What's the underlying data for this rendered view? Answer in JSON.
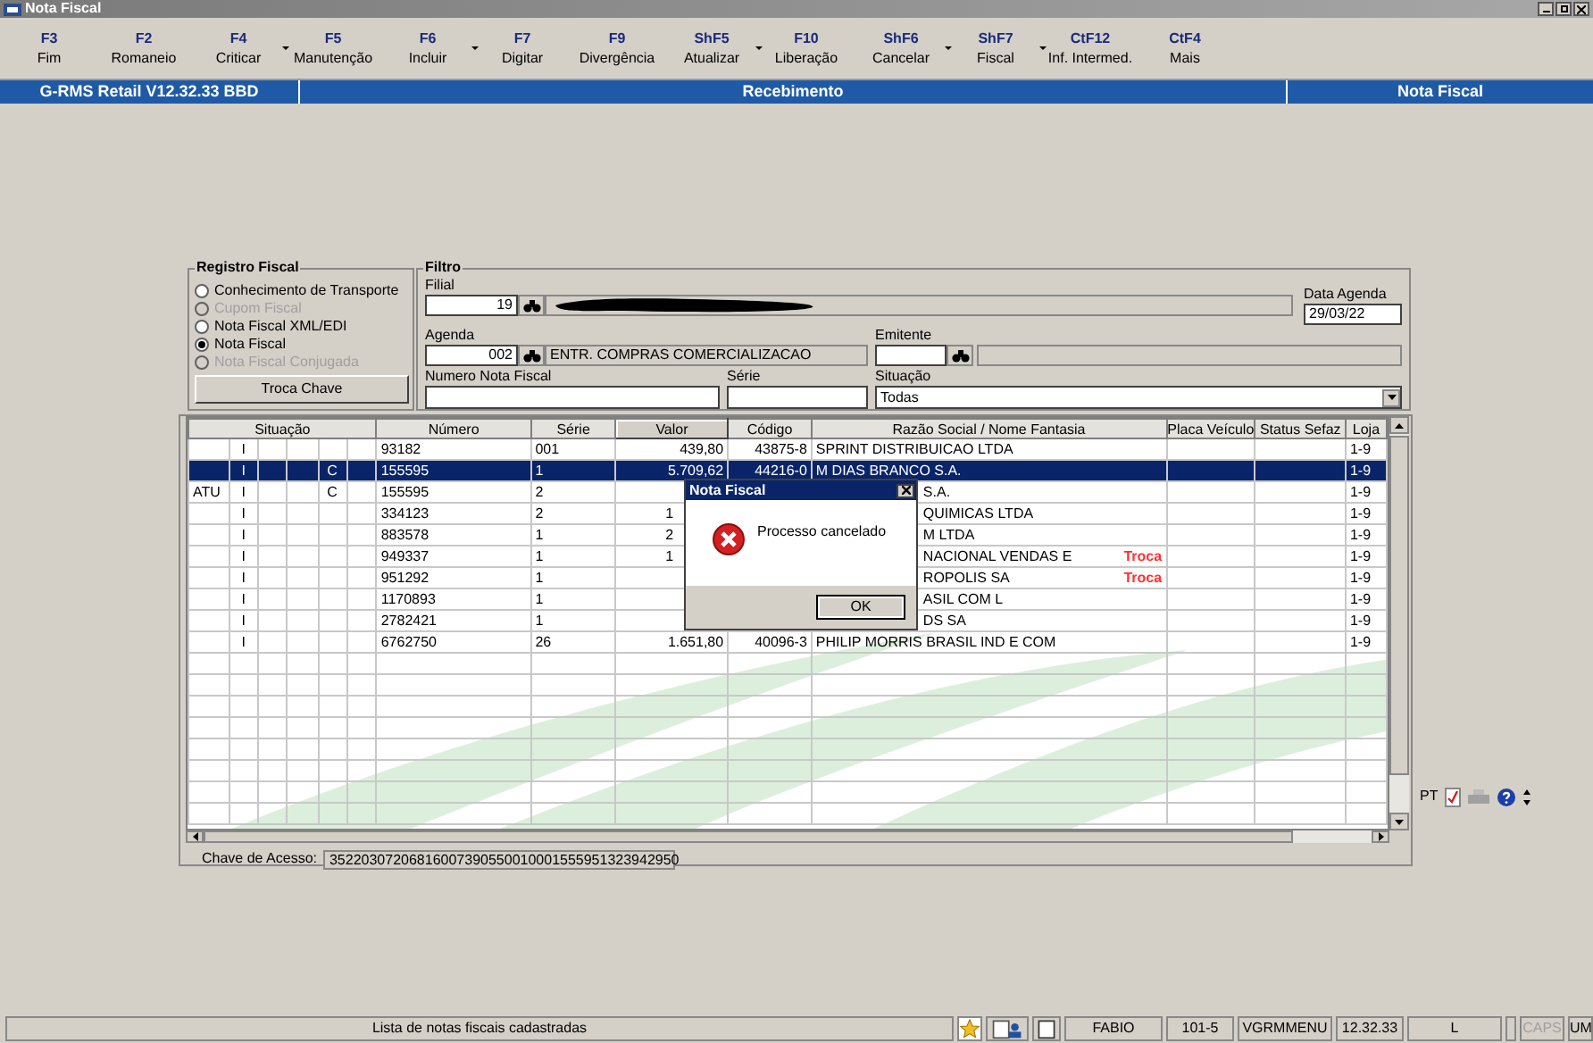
{
  "window": {
    "title": "Nota Fiscal"
  },
  "toolbar": [
    {
      "key": "F3",
      "label": "Fim",
      "has_menu": false
    },
    {
      "key": "F2",
      "label": "Romaneio",
      "has_menu": false
    },
    {
      "key": "F4",
      "label": "Criticar",
      "has_menu": true
    },
    {
      "key": "F5",
      "label": "Manutenção",
      "has_menu": false
    },
    {
      "key": "F6",
      "label": "Incluir",
      "has_menu": true
    },
    {
      "key": "F7",
      "label": "Digitar",
      "has_menu": false
    },
    {
      "key": "F9",
      "label": "Divergência",
      "has_menu": false
    },
    {
      "key": "ShF5",
      "label": "Atualizar",
      "has_menu": true
    },
    {
      "key": "F10",
      "label": "Liberação",
      "has_menu": false
    },
    {
      "key": "ShF6",
      "label": "Cancelar",
      "has_menu": true
    },
    {
      "key": "ShF7",
      "label": "Fiscal",
      "has_menu": true
    },
    {
      "key": "CtF12",
      "label": "Inf. Intermed.",
      "has_menu": false
    },
    {
      "key": "CtF4",
      "label": "Mais",
      "has_menu": false
    }
  ],
  "header_bar": {
    "system": "G-RMS Retail V12.32.33 BBD",
    "module": "Recebimento",
    "screen": "Nota Fiscal"
  },
  "registro_fiscal": {
    "title": "Registro Fiscal",
    "options": [
      {
        "label": "Conhecimento de Transporte",
        "selected": false,
        "disabled": false
      },
      {
        "label": "Cupom Fiscal",
        "selected": false,
        "disabled": true
      },
      {
        "label": "Nota Fiscal XML/EDI",
        "selected": false,
        "disabled": false
      },
      {
        "label": "Nota Fiscal",
        "selected": true,
        "disabled": false
      },
      {
        "label": "Nota Fiscal Conjugada",
        "selected": false,
        "disabled": true
      }
    ],
    "button": "Troca Chave"
  },
  "filtro": {
    "title": "Filtro",
    "filial": {
      "label": "Filial",
      "value": "19"
    },
    "data_agenda": {
      "label": "Data Agenda",
      "value": "29/03/22"
    },
    "agenda": {
      "label": "Agenda",
      "value": "002",
      "description": "ENTR. COMPRAS COMERCIALIZACAO"
    },
    "emitente": {
      "label": "Emitente"
    },
    "numero": {
      "label": "Numero Nota Fiscal"
    },
    "serie": {
      "label": "Série"
    },
    "situacao": {
      "label": "Situação",
      "value": "Todas"
    }
  },
  "table": {
    "columns": [
      {
        "label": "Situação",
        "sorted": false
      },
      {
        "label": "Número",
        "sorted": false
      },
      {
        "label": "Série",
        "sorted": false
      },
      {
        "label": "Valor",
        "sorted": true
      },
      {
        "label": "Código",
        "sorted": false
      },
      {
        "label": "Razão Social / Nome Fantasia",
        "sorted": false
      },
      {
        "label": "Placa Veículo",
        "sorted": false
      },
      {
        "label": "Status Sefaz",
        "sorted": false
      },
      {
        "label": "Loja",
        "sorted": false
      }
    ],
    "rows": [
      {
        "status_2": "I",
        "numero": "93182",
        "serie": "001",
        "valor": "439,80",
        "codigo": "43875-8",
        "razao": "SPRINT DISTRIBUICAO LTDA",
        "loja": "1-9",
        "selected": false
      },
      {
        "status_2": "I",
        "status_5": "C",
        "numero": "155595",
        "serie": "1",
        "valor": "5.709,62",
        "codigo": "44216-0",
        "razao": "M DIAS BRANCO S.A.",
        "loja": "1-9",
        "selected": true
      },
      {
        "status_1": "ATU",
        "status_2": "I",
        "status_5": "C",
        "numero": "155595",
        "serie": "2",
        "razao": "S.A.",
        "loja": "1-9",
        "selected": false
      },
      {
        "status_2": "I",
        "numero": "334123",
        "serie": "2",
        "valor": "1",
        "razao": "QUIMICAS LTDA",
        "loja": "1-9",
        "selected": false
      },
      {
        "status_2": "I",
        "numero": "883578",
        "serie": "1",
        "valor": "2",
        "razao": "M LTDA",
        "loja": "1-9",
        "selected": false
      },
      {
        "status_2": "I",
        "numero": "949337",
        "serie": "1",
        "valor": "1",
        "razao": "NACIONAL VENDAS E",
        "tag": "Troca",
        "loja": "1-9",
        "selected": false
      },
      {
        "status_2": "I",
        "numero": "951292",
        "serie": "1",
        "razao": "ROPOLIS SA",
        "tag": "Troca",
        "loja": "1-9",
        "selected": false
      },
      {
        "status_2": "I",
        "numero": "1170893",
        "serie": "1",
        "razao": "ASIL COM L",
        "loja": "1-9",
        "selected": false
      },
      {
        "status_2": "I",
        "numero": "2782421",
        "serie": "1",
        "razao": "DS SA",
        "loja": "1-9",
        "selected": false
      },
      {
        "status_2": "I",
        "numero": "6762750",
        "serie": "26",
        "valor": "1.651,80",
        "codigo": "40096-3",
        "razao": "PHILIP MORRIS BRASIL IND E COM",
        "loja": "1-9",
        "selected": false
      }
    ]
  },
  "dialog": {
    "title": "Nota Fiscal",
    "message": "Processo cancelado",
    "button": "OK"
  },
  "chave": {
    "label": "Chave de Acesso:",
    "value": "35220307206816007390550010001555951323942950"
  },
  "side_tools": {
    "language": "PT"
  },
  "status_bar": {
    "message": "Lista de notas fiscais cadastradas",
    "user": "FABIO",
    "code": "101-5",
    "menu": "VGRMMENU",
    "version": "12.32.33",
    "mode": "L",
    "caps": {
      "label": "CAPS",
      "active": false
    },
    "num": {
      "label": "UM",
      "active": true
    }
  }
}
